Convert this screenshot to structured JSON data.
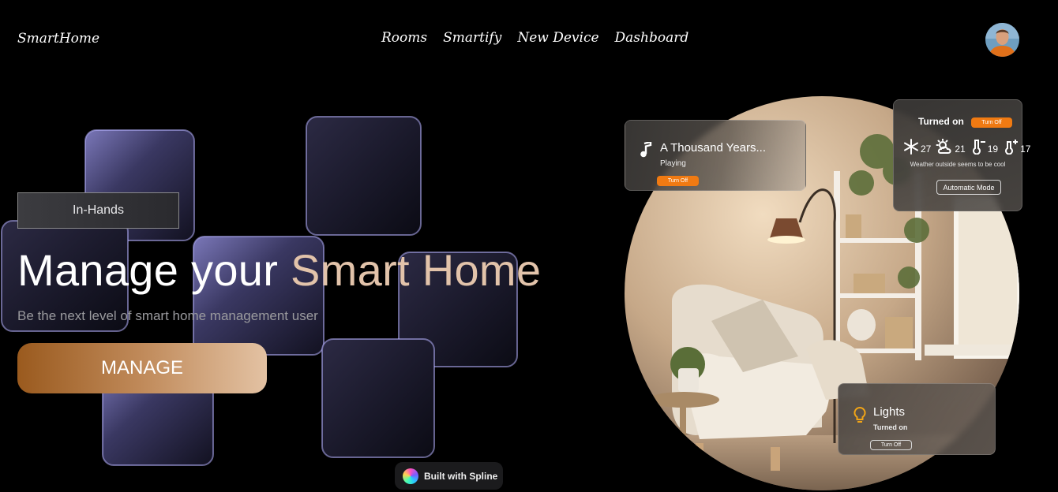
{
  "brand": {
    "name": "SmartHome"
  },
  "nav": {
    "items": [
      "Rooms",
      "Smartify",
      "New Device",
      "Dashboard"
    ]
  },
  "profile": {
    "avatar": "user-avatar"
  },
  "hero": {
    "badge": "In-Hands",
    "headline_main": "Manage your ",
    "headline_accent": "Smart Home",
    "subtitle": "Be the next level of smart home management user",
    "cta": "MANAGE"
  },
  "music_card": {
    "icon": "music-note-icon",
    "title": "A Thousand Years...",
    "status": "Playing",
    "button": "Turn Off"
  },
  "climate_card": {
    "status": "Turned on",
    "button": "Turn Off",
    "readings": [
      {
        "icon": "snowflake-icon",
        "value": "27"
      },
      {
        "icon": "partly-cloudy-icon",
        "value": "21"
      },
      {
        "icon": "thermometer-minus-icon",
        "value": "19"
      },
      {
        "icon": "thermometer-plus-icon",
        "value": "17"
      }
    ],
    "note": "Weather outside seems to be cool",
    "mode_button": "Automatic Mode"
  },
  "lights_card": {
    "icon": "lightbulb-icon",
    "title": "Lights",
    "status": "Turned on",
    "button": "Turn Off"
  },
  "spline_badge": {
    "label": "Built with Spline"
  },
  "colors": {
    "accent_orange": "#f07a12",
    "headline_accent": "#e2c3aa",
    "cta_start": "#9a5a1e",
    "cta_end": "#e3c2a3"
  }
}
